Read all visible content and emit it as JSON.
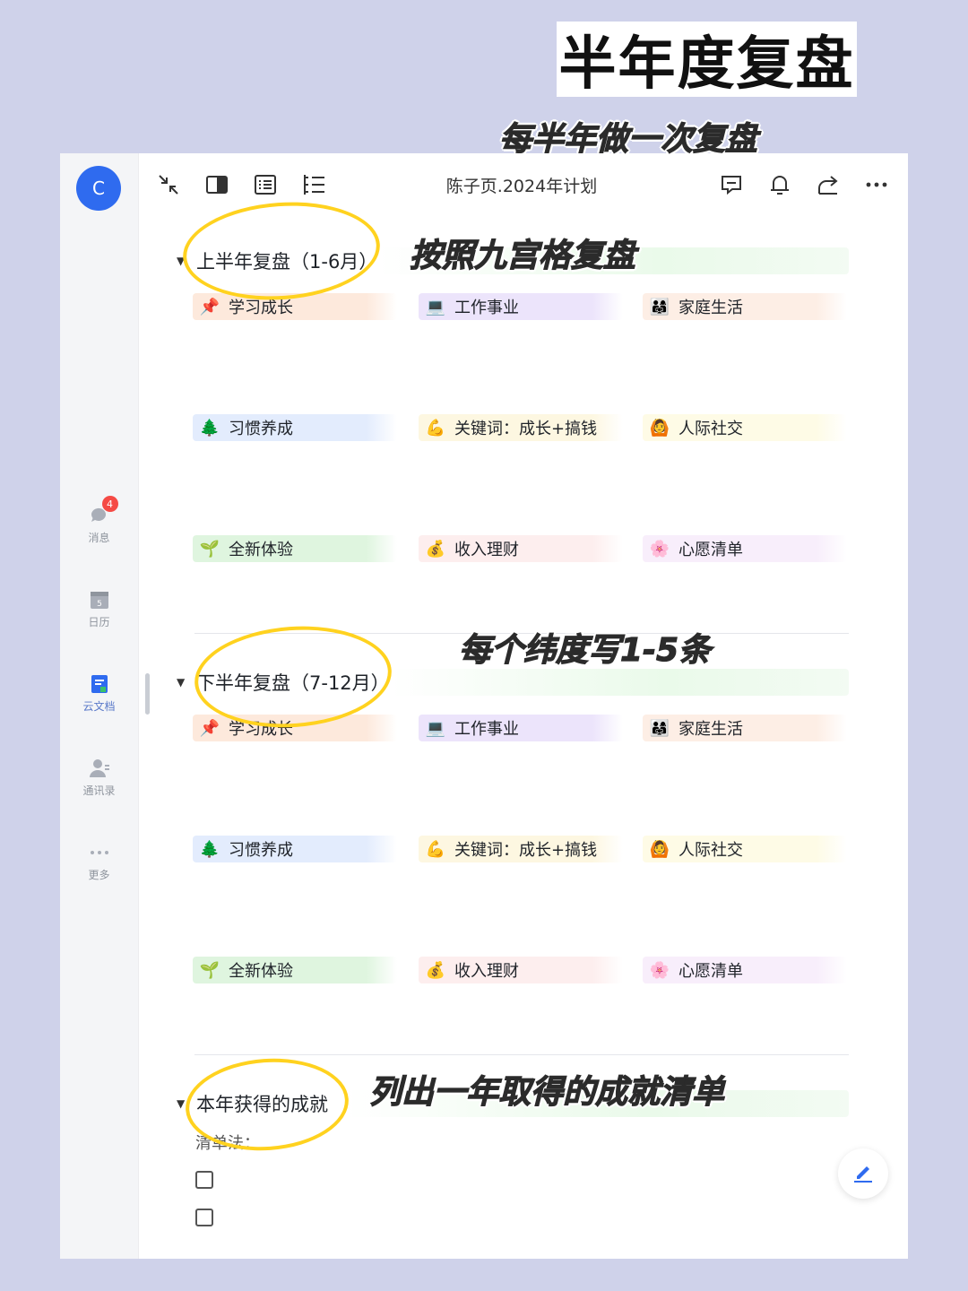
{
  "overlay": {
    "title": "半年度复盘",
    "annotations": {
      "every_half_year": "每半年做一次复盘",
      "nine_grid": "按照九宫格复盘",
      "per_dimension": "每个纬度写1-5条",
      "achievements": "列出一年取得的成就清单"
    },
    "annotation_color": "#2b2b2b",
    "circle_color": "#ffd21f"
  },
  "sidebar": {
    "avatar_letter": "C",
    "items": [
      {
        "label": "消息",
        "icon": "chat-bubble-icon",
        "badge": "4"
      },
      {
        "label": "日历",
        "icon": "calendar-icon",
        "day": "5"
      },
      {
        "label": "云文档",
        "icon": "cloud-doc-icon"
      },
      {
        "label": "通讯录",
        "icon": "contacts-icon"
      },
      {
        "label": "更多",
        "icon": "more-dots-icon"
      }
    ]
  },
  "toolbar": {
    "doc_title": "陈子页.2024年计划",
    "left_icons": [
      "collapse-icon",
      "sidebar-toggle-icon",
      "list-icon",
      "outline-icon"
    ],
    "right_icons": [
      "comment-icon",
      "bell-icon",
      "share-icon",
      "more-icon"
    ]
  },
  "sections": {
    "h1": {
      "title": "上半年复盘（1-6月）"
    },
    "h2": {
      "title": "下半年复盘（7-12月）"
    },
    "h3": {
      "title": "本年获得的成就",
      "list_label": "清单法："
    }
  },
  "grid": [
    {
      "label": "学习成长",
      "emoji": "📌",
      "color": "#fde9dc"
    },
    {
      "label": "工作事业",
      "emoji": "💻",
      "color": "#ece4fb"
    },
    {
      "label": "家庭生活",
      "emoji": "👨‍👩‍👧",
      "color": "#fdeee5"
    },
    {
      "label": "习惯养成",
      "emoji": "🌲",
      "color": "#e3ecfd"
    },
    {
      "label": "关键词：成长+搞钱",
      "emoji": "💪",
      "color": "#fdf7e1"
    },
    {
      "label": "人际社交",
      "emoji": "🙆",
      "color": "#fefbe6"
    },
    {
      "label": "全新体验",
      "emoji": "🌱",
      "color": "#dff5df"
    },
    {
      "label": "收入理财",
      "emoji": "💰",
      "color": "#fdeeee"
    },
    {
      "label": "心愿清单",
      "emoji": "🌸",
      "color": "#f8eefb"
    }
  ]
}
